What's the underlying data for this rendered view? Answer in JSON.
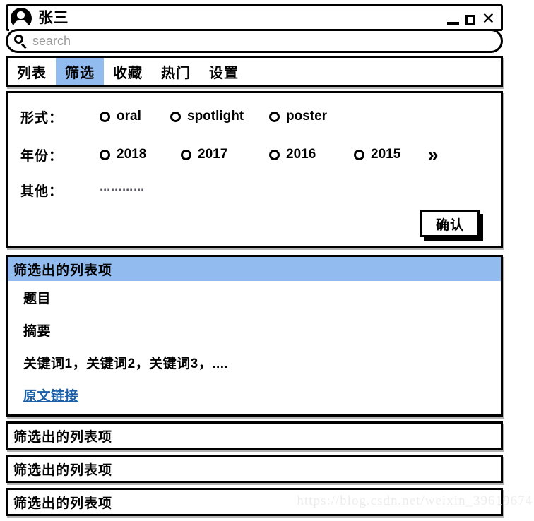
{
  "window": {
    "user_name": "张三",
    "avatar_icon": "user-avatar-icon",
    "controls": {
      "minimize_label": "—",
      "maximize_label": "□",
      "close_label": "✕"
    }
  },
  "search": {
    "icon": "search-icon",
    "value": "",
    "placeholder": "search"
  },
  "tabs": [
    {
      "label": "列表",
      "active": false
    },
    {
      "label": "筛选",
      "active": true
    },
    {
      "label": "收藏",
      "active": false
    },
    {
      "label": "热门",
      "active": false
    },
    {
      "label": "设置",
      "active": false
    }
  ],
  "filter": {
    "rows": [
      {
        "label": "形式：",
        "options": [
          {
            "label": "oral",
            "selected": false
          },
          {
            "label": "spotlight",
            "selected": false
          },
          {
            "label": "poster",
            "selected": false
          }
        ],
        "more": ""
      },
      {
        "label": "年份：",
        "options": [
          {
            "label": "2018",
            "selected": false
          },
          {
            "label": "2017",
            "selected": false
          },
          {
            "label": "2016",
            "selected": false
          },
          {
            "label": "2015",
            "selected": false
          }
        ],
        "more": "»"
      }
    ],
    "other": {
      "label": "其他：",
      "value": "",
      "placeholder": "⋯⋯⋯⋯"
    },
    "confirm_label": "确认"
  },
  "results": {
    "expanded": {
      "header": "筛选出的列表项",
      "title": "题目",
      "abstract": "摘要",
      "keywords": "关键词1，关键词2，关键词3，....",
      "link_label": "原文链接"
    },
    "collapsed": [
      {
        "header": "筛选出的列表项"
      },
      {
        "header": "筛选出的列表项"
      },
      {
        "header": "筛选出的列表项"
      }
    ]
  },
  "watermark": "https://blog.csdn.net/weixin_39619674",
  "colors": {
    "accent_blue": "#92bbf0",
    "link_blue": "#1a5fa8",
    "border_black": "#000000",
    "placeholder_gray": "#9a9a9a"
  }
}
